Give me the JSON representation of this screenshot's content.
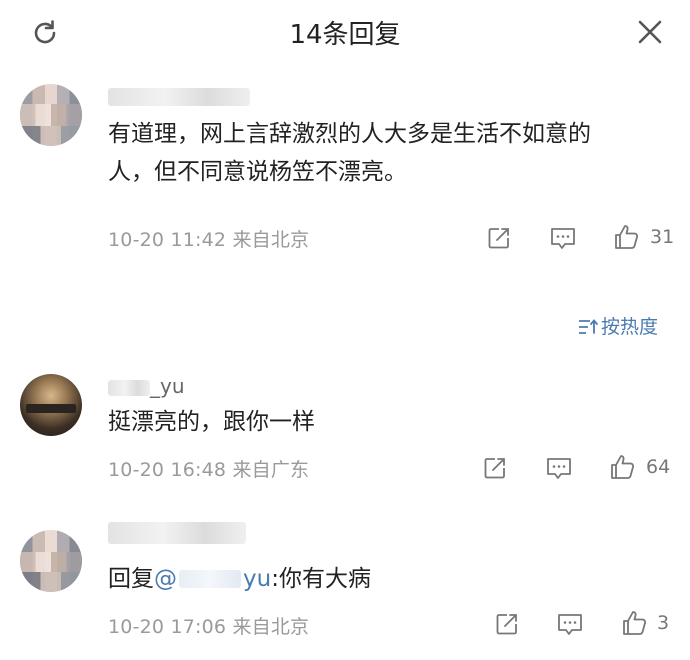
{
  "header": {
    "title": "14条回复"
  },
  "sort": {
    "label": "按热度"
  },
  "comments": [
    {
      "name": "",
      "content_line1": "有道理，网上言辞激烈的人大多是生活不如意的",
      "content_line2": "人，但不同意说杨笠不漂亮。",
      "meta": "10-20 11:42  来自北京",
      "likes": "31"
    },
    {
      "name": "_yu",
      "content": "挺漂亮的，跟你一样",
      "meta": "10-20 16:48  来自广东",
      "likes": "64"
    },
    {
      "name": "",
      "reply_prefix": "回复",
      "mention": "@",
      "mention_tail": "yu",
      "reply_text": ":你有大病",
      "meta": "10-20 17:06  来自北京",
      "likes": "3"
    }
  ],
  "icons": {
    "refresh": "refresh-icon",
    "close": "close-icon",
    "share": "share-icon",
    "comment": "comment-icon",
    "like": "thumbs-up-icon",
    "sort": "sort-icon"
  },
  "colors": {
    "link": "#4a7bb0",
    "meta": "#9a9a9a",
    "text": "#222222"
  }
}
